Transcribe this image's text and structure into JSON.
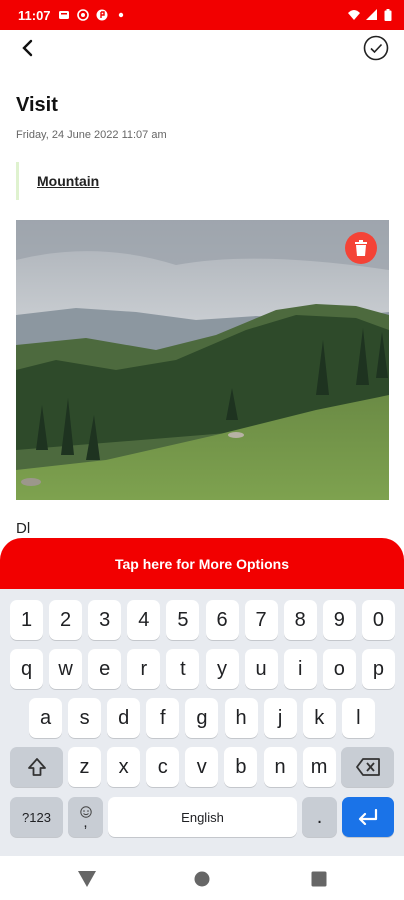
{
  "status_bar": {
    "time": "11:07",
    "left_icons": [
      "notification-icon",
      "whatsapp-icon",
      "app-icon",
      "dot-icon"
    ],
    "right_icons": [
      "wifi-icon",
      "signal-icon",
      "battery-icon"
    ]
  },
  "toolbar": {
    "back_icon": "arrow-back-icon",
    "save_icon": "check-circle-icon"
  },
  "note": {
    "title": "Visit",
    "date": "Friday, 24 June 2022 11:07 am",
    "tag": "Mountain",
    "body": "Dl"
  },
  "photo": {
    "delete_icon": "trash-icon",
    "delete_color": "#f44336"
  },
  "options_bar": {
    "label": "Tap here for More Options",
    "color": "#f20000"
  },
  "keyboard": {
    "row_numbers": [
      "1",
      "2",
      "3",
      "4",
      "5",
      "6",
      "7",
      "8",
      "9",
      "0"
    ],
    "row1": [
      "q",
      "w",
      "e",
      "r",
      "t",
      "y",
      "u",
      "i",
      "o",
      "p"
    ],
    "row2": [
      "a",
      "s",
      "d",
      "f",
      "g",
      "h",
      "j",
      "k",
      "l"
    ],
    "row3": [
      "z",
      "x",
      "c",
      "v",
      "b",
      "n",
      "m"
    ],
    "symbols_label": "?123",
    "emoji_comma": ",",
    "space_label": "English",
    "period": ".",
    "shift_icon": "shift-icon",
    "backspace_icon": "backspace-icon",
    "enter_icon": "enter-icon"
  },
  "navigation_bar": {
    "back_icon": "nav-back-icon",
    "home_icon": "nav-home-icon",
    "recents_icon": "nav-recents-icon"
  }
}
